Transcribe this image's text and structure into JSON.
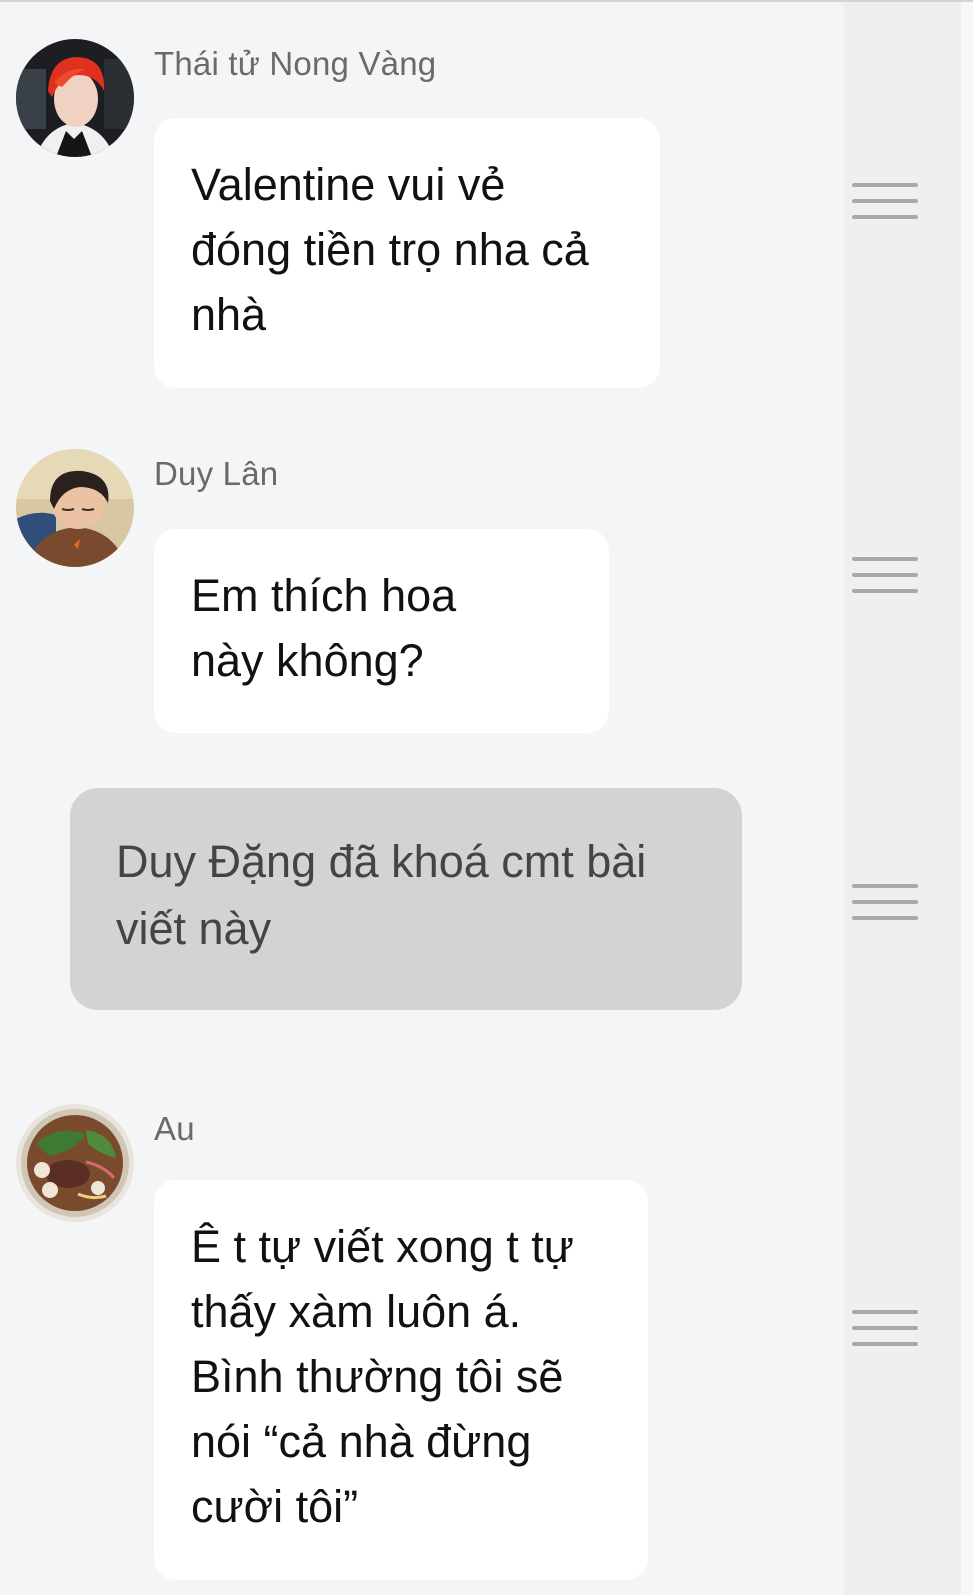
{
  "comments": [
    {
      "author": "Thái tử Nong Vàng",
      "avatar_icon": "avatar-red-hair-man",
      "lines": [
        "Valentine vui vẻ",
        "đóng tiền trọ nha cả",
        "nhà"
      ]
    },
    {
      "author": "Duy Lân",
      "avatar_icon": "avatar-sleeping-man",
      "lines": [
        "Em thích hoa",
        "này không?"
      ]
    },
    {
      "author": "Au",
      "avatar_icon": "avatar-noodle-bowl",
      "lines": [
        "Ê t tự viết xong t tự",
        "thấy xàm luôn á.",
        "Bình thường tôi sẽ",
        "nói “cả nhà đừng",
        "cười tôi”"
      ]
    }
  ],
  "locked_notice": {
    "lines": [
      "Duy Đặng đã khoá cmt bài",
      "viết này"
    ]
  },
  "menu_icon": "hamburger-menu-icon",
  "colors": {
    "background": "#f4f5f7",
    "bubble": "#ffffff",
    "locked_bubble": "#d3d3d5",
    "author_text": "#6a6a6a",
    "message_text": "#111111",
    "menu_lines": "#a9a9ac"
  }
}
